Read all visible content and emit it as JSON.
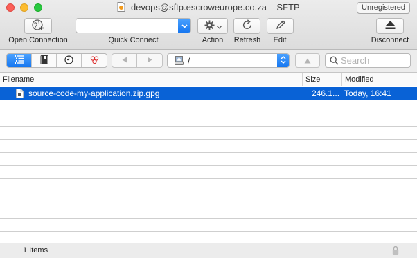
{
  "window": {
    "title": "devops@sftp.escroweurope.co.za – SFTP",
    "badge": "Unregistered"
  },
  "toolbar": {
    "open_connection": "Open Connection",
    "quick_connect": "Quick Connect",
    "quick_connect_value": "",
    "action": "Action",
    "refresh": "Refresh",
    "edit": "Edit",
    "disconnect": "Disconnect"
  },
  "navbar": {
    "path": "/",
    "search_placeholder": "Search",
    "view_modes": [
      "browser-icon",
      "bookmarks-icon",
      "history-icon",
      "bonjour-icon"
    ],
    "active_view": "browser-icon"
  },
  "table": {
    "columns": [
      "Filename",
      "Size",
      "Modified"
    ],
    "rows": [
      {
        "filename": "source-code-my-application.zip.gpg",
        "size": "246.1...",
        "modified": "Today, 16:41",
        "selected": true
      }
    ]
  },
  "status": {
    "items": "1 Items"
  },
  "colors": {
    "selection": "#0962d6",
    "accent": "#1677f0"
  }
}
